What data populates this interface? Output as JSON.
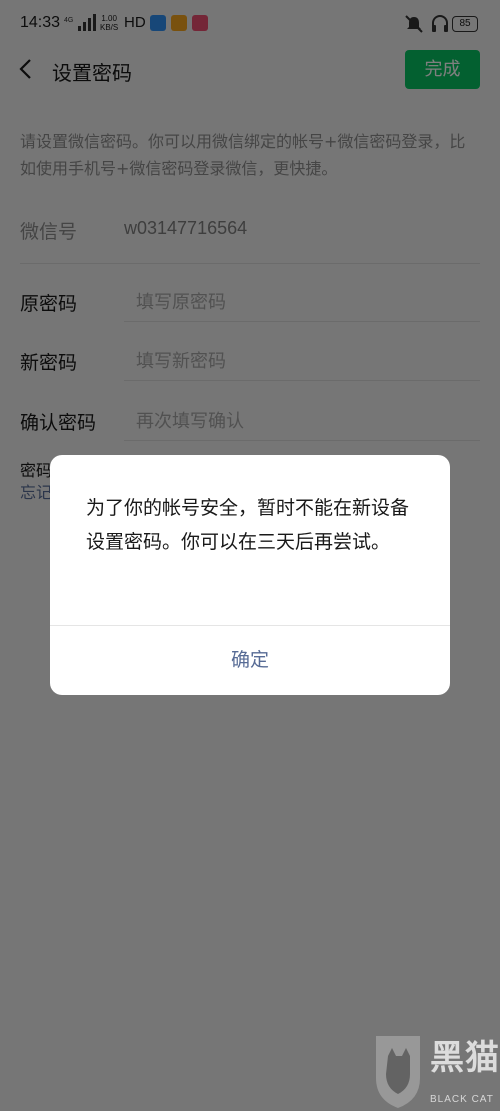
{
  "status_bar": {
    "time": "14:33",
    "speed_value": "1.00",
    "speed_unit": "KB/S",
    "hd": "HD",
    "battery": "85"
  },
  "nav": {
    "title": "设置密码",
    "done_label": "完成"
  },
  "hint": "请设置微信密码。你可以用微信绑定的帐号+微信密码登录，比如使用手机号+微信密码登录微信，更快捷。",
  "wechat_id": {
    "label": "微信号",
    "value": "w03147716564"
  },
  "fields": [
    {
      "label": "原密码",
      "placeholder": "填写原密码"
    },
    {
      "label": "新密码",
      "placeholder": "填写新密码"
    },
    {
      "label": "确认密码",
      "placeholder": "再次填写确认"
    }
  ],
  "tip": {
    "line1": "密码",
    "line2": "忘记"
  },
  "dialog": {
    "message": "为了你的帐号安全，暂时不能在新设备设置密码。你可以在三天后再尝试。",
    "confirm_label": "确定"
  },
  "watermark": {
    "text": "黑猫",
    "sub": "BLACK CAT"
  },
  "colors": {
    "accent_green": "#07c160",
    "link_blue": "#576b95"
  }
}
